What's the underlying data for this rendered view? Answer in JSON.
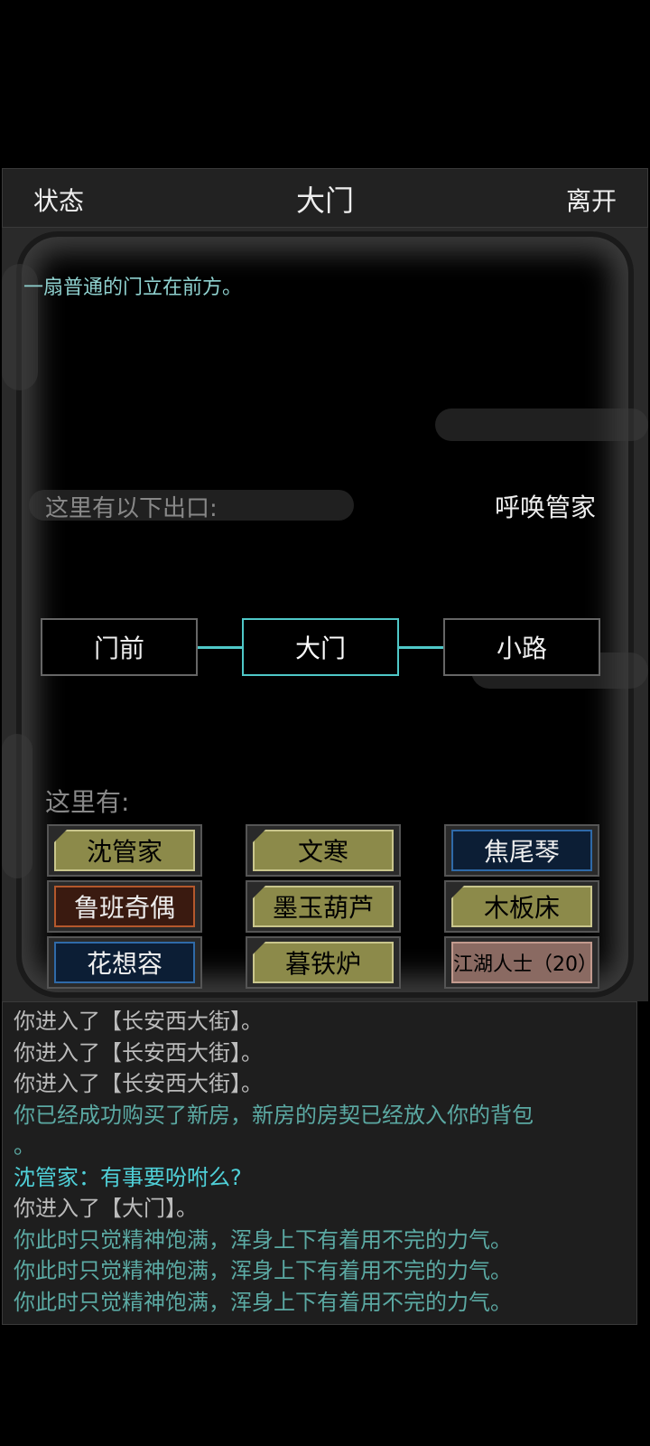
{
  "header": {
    "left": "状态",
    "title": "大门",
    "right": "离开"
  },
  "scene": {
    "description": "一扇普通的门立在前方。",
    "exits_label": "这里有以下出口:",
    "summon": "呼唤管家",
    "exits": [
      {
        "label": "门前",
        "current": false
      },
      {
        "label": "大门",
        "current": true
      },
      {
        "label": "小路",
        "current": false
      }
    ],
    "here_label": "这里有:",
    "entities": [
      [
        "沈管家",
        "文寒",
        "焦尾琴"
      ],
      [
        "鲁班奇偶",
        "墨玉葫芦",
        "木板床"
      ],
      [
        "花想容",
        "暮铁炉",
        "江湖人士（20）"
      ]
    ]
  },
  "log": [
    {
      "text": "你进入了【长安西大街】。",
      "color": "grey"
    },
    {
      "text": "你进入了【长安西大街】。",
      "color": "grey"
    },
    {
      "text": "你进入了【长安西大街】。",
      "color": "grey"
    },
    {
      "text": "你已经成功购买了新房，新房的房契已经放入你的背包",
      "color": "teal"
    },
    {
      "text": "。",
      "color": "teal"
    },
    {
      "text": "沈管家：有事要吩咐么?",
      "color": "cyan"
    },
    {
      "text": "你进入了【大门】。",
      "color": "grey"
    },
    {
      "text": "你此时只觉精神饱满，浑身上下有着用不完的力气。",
      "color": "teal"
    },
    {
      "text": "你此时只觉精神饱满，浑身上下有着用不完的力气。",
      "color": "teal"
    },
    {
      "text": "你此时只觉精神饱满，浑身上下有着用不完的力气。",
      "color": "teal"
    }
  ]
}
